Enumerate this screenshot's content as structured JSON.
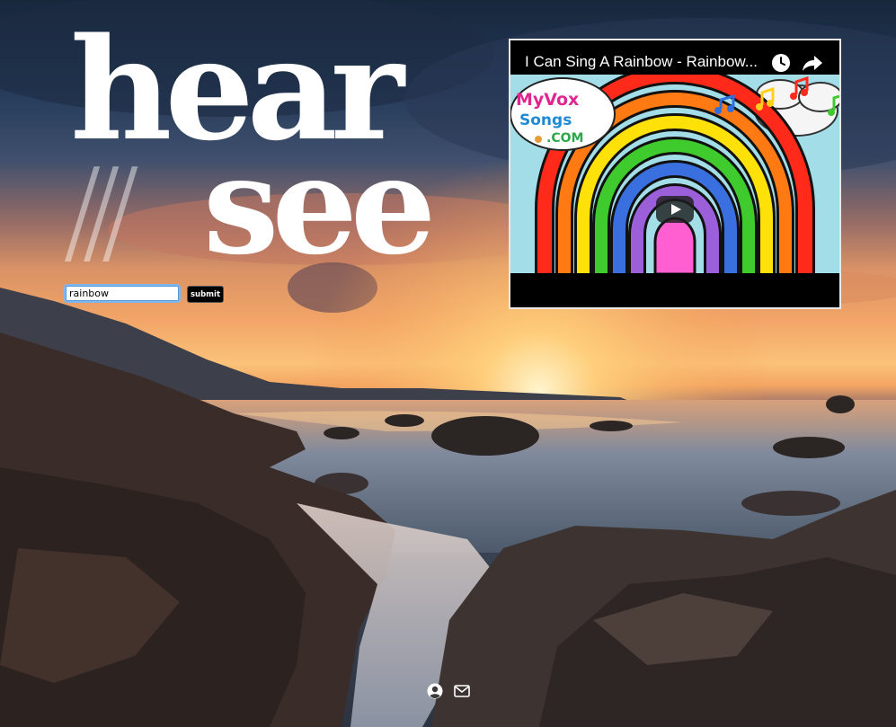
{
  "logo": {
    "line1": "hear",
    "slashes": "///",
    "line2": "see"
  },
  "search": {
    "value": "rainbow",
    "submit_label": "submit"
  },
  "video": {
    "title": "I Can Sing A Rainbow - Rainbow...",
    "channel_logo_text": [
      "MyVox",
      "Songs",
      ".COM"
    ],
    "icons": [
      "clock-icon",
      "share-icon",
      "play-icon"
    ]
  },
  "footer": {
    "icons": [
      "user-circle-icon",
      "envelope-icon"
    ]
  },
  "colors": {
    "text": "#ffffff",
    "input_focus": "#7fb6ef",
    "button_bg": "#000000",
    "video_sky": "#a3dde8"
  }
}
